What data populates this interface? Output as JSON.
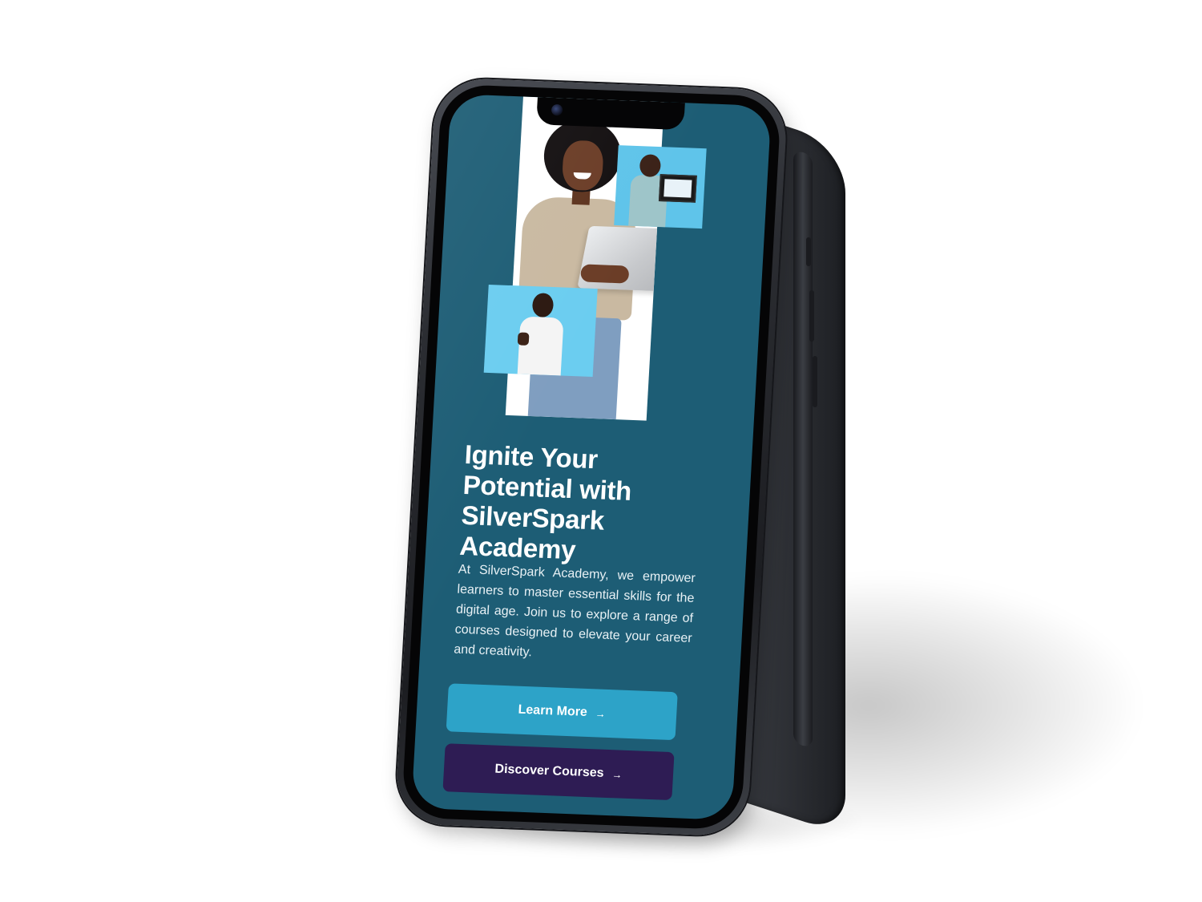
{
  "hero": {
    "title": "Ignite Your Potential with SilverSpark Academy",
    "description": "At SilverSpark Academy, we empower learners to master essential skills for the digital age. Join us to explore a range of courses designed to elevate your career and creativity."
  },
  "buttons": {
    "learn_more": "Learn More",
    "discover_courses": "Discover Courses",
    "arrow_glyph": "→"
  },
  "icons": {
    "arrow": "arrow-right-icon",
    "camera": "front-camera-icon"
  },
  "colors": {
    "screen_background": "#1d5d75",
    "learn_more_button": "#2da3c8",
    "discover_button": "#2e1c54",
    "text": "#ffffff",
    "phone_frame": "#2b2d32"
  }
}
